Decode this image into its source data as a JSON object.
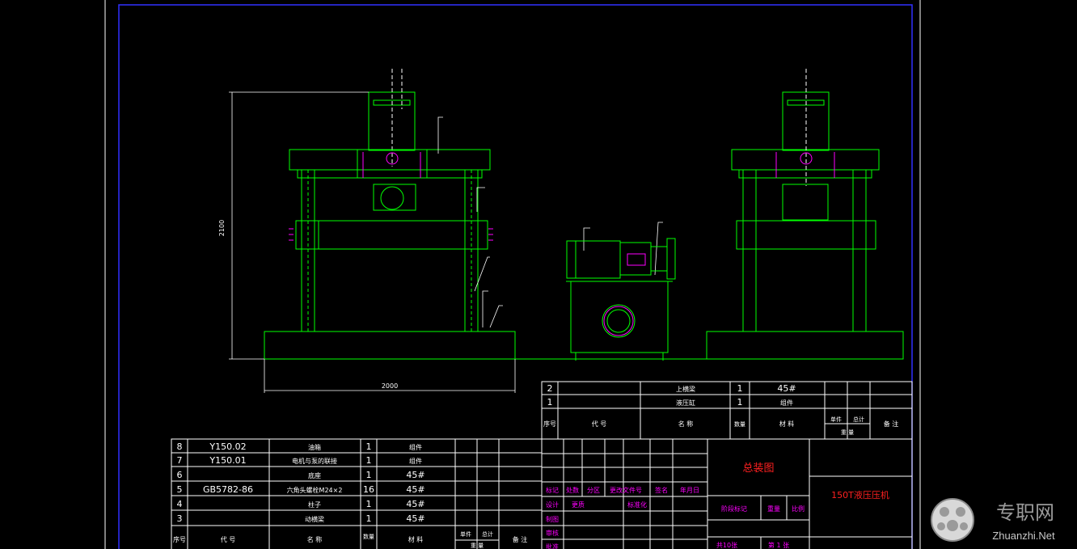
{
  "dimensions": {
    "height": "2100",
    "width": "2000"
  },
  "bom_upper": {
    "rows": [
      {
        "no": "2",
        "code": "",
        "name": "上横梁",
        "qty": "1",
        "material": "45#"
      },
      {
        "no": "1",
        "code": "",
        "name": "液压缸",
        "qty": "1",
        "material": "组件"
      }
    ],
    "header": {
      "no": "序号",
      "code": "代 号",
      "name": "名 称",
      "qty": "数量",
      "material": "材 料",
      "unit_weight": "单件",
      "total_weight": "总计",
      "weight": "重 量",
      "remark": "备 注"
    }
  },
  "bom_lower": {
    "rows": [
      {
        "no": "8",
        "code": "Y150.02",
        "name": "油箱",
        "qty": "1",
        "material": "组件"
      },
      {
        "no": "7",
        "code": "Y150.01",
        "name": "电机与泵的联接",
        "qty": "1",
        "material": "组件"
      },
      {
        "no": "6",
        "code": "",
        "name": "底座",
        "qty": "1",
        "material": "45#"
      },
      {
        "no": "5",
        "code": "GB5782-86",
        "name": "六角头螺栓M24×2",
        "qty": "16",
        "material": "45#"
      },
      {
        "no": "4",
        "code": "",
        "name": "柱子",
        "qty": "1",
        "material": "45#"
      },
      {
        "no": "3",
        "code": "",
        "name": "动横梁",
        "qty": "1",
        "material": "45#"
      }
    ],
    "header": {
      "no": "序号",
      "code": "代 号",
      "name": "名 称",
      "qty": "数量",
      "material": "材 料",
      "unit_weight": "单件",
      "total_weight": "总计",
      "weight": "重 量",
      "remark": "备 注"
    }
  },
  "title_block": {
    "drawing_name": "总装图",
    "product_name": "150T液压压机",
    "rev_headers": [
      "标记",
      "处数",
      "分区",
      "更改文件号",
      "签名",
      "年月日"
    ],
    "sign_rows": [
      "设计",
      "制图",
      "审核",
      "批准"
    ],
    "sign_extra": [
      "更质",
      "标准化"
    ],
    "stage_labels": [
      "阶段标记",
      "重量",
      "比例"
    ],
    "sheet_total": "共10张",
    "sheet_no": "第 1 张"
  },
  "watermark": {
    "cn": "专职网",
    "en": "Zhuanzhi.Net"
  },
  "colors": {
    "line": "#00ff00",
    "frame": "#3030ff",
    "title": "#ff2020",
    "accent": "#ff00ff",
    "text": "#ffffff"
  }
}
